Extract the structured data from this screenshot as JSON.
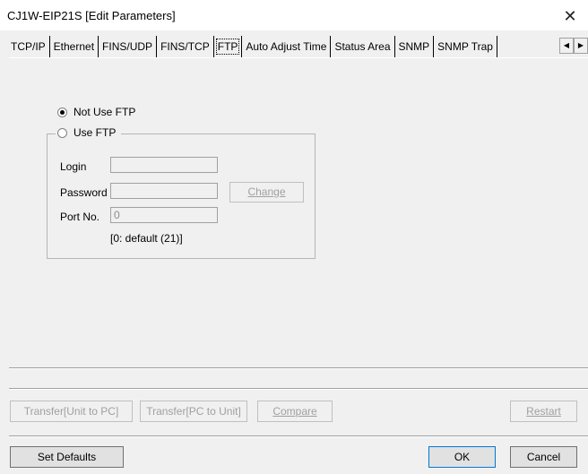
{
  "window": {
    "title": "CJ1W-EIP21S [Edit Parameters]",
    "close": "✕"
  },
  "tabs": [
    {
      "label": "TCP/IP"
    },
    {
      "label": "Ethernet"
    },
    {
      "label": "FINS/UDP"
    },
    {
      "label": "FINS/TCP"
    },
    {
      "label": "FTP",
      "active": true
    },
    {
      "label": "Auto Adjust Time"
    },
    {
      "label": "Status Area"
    },
    {
      "label": "SNMP"
    },
    {
      "label": "SNMP Trap"
    }
  ],
  "tab_scroll": {
    "left": "◀",
    "right": "▶"
  },
  "ftp": {
    "not_use_label": "Not Use FTP",
    "use_label": "Use FTP",
    "selected": "Not Use FTP",
    "login_label": "Login",
    "login_value": "",
    "password_label": "Password",
    "password_value": "",
    "change_label": "Change",
    "port_label": "Port No.",
    "port_value": "0",
    "port_hint": "[0: default (21)]"
  },
  "transfer": {
    "unit_to_pc": "Transfer[Unit to PC]",
    "pc_to_unit": "Transfer[PC to Unit]",
    "compare": "Compare",
    "restart": "Restart"
  },
  "footer": {
    "set_defaults": "Set Defaults",
    "ok": "OK",
    "cancel": "Cancel"
  }
}
